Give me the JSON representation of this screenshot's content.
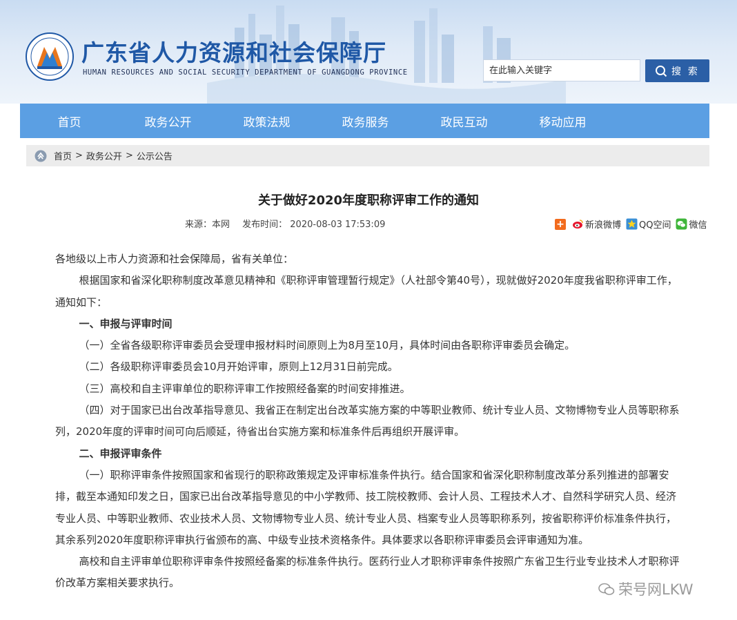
{
  "header": {
    "title": "广东省人力资源和社会保障厅",
    "subtitle": "HUMAN RESOURCES AND SOCIAL SECURITY DEPARTMENT OF GUANGDONG PROVINCE",
    "search_placeholder": "在此输入关键字",
    "search_button": "搜 索"
  },
  "nav": {
    "items": [
      "首页",
      "政务公开",
      "政策法规",
      "政务服务",
      "政民互动",
      "移动应用"
    ]
  },
  "breadcrumb": {
    "items": [
      "首页",
      "政务公开",
      "公示公告"
    ],
    "separator": ">"
  },
  "article": {
    "title": "关于做好2020年度职称评审工作的通知",
    "source": "来源：本网",
    "published": "发布时间： 2020-08-03 17:53:09",
    "paragraphs": [
      "各地级以上市人力资源和社会保障局，省有关单位：",
      "根据国家和省深化职称制度改革意见精神和《职称评审管理暂行规定》（人社部令第40号），现就做好2020年度我省职称评审工作，通知如下：",
      "一、申报与评审时间",
      "（一）全省各级职称评审委员会受理申报材料时间原则上为8月至10月，具体时间由各职称评审委员会确定。",
      "（二）各级职称评审委员会10月开始评审，原则上12月31日前完成。",
      "（三）高校和自主评审单位的职称评审工作按照经备案的时间安排推进。",
      "（四）对于国家已出台改革指导意见、我省正在制定出台改革实施方案的中等职业教师、统计专业人员、文物博物专业人员等职称系列，2020年度的评审时间可向后顺延，待省出台实施方案和标准条件后再组织开展评审。",
      "二、申报评审条件",
      "（一）职称评审条件按照国家和省现行的职称政策规定及评审标准条件执行。结合国家和省深化职称制度改革分系列推进的部署安排，截至本通知印发之日，国家已出台改革指导意见的中小学教师、技工院校教师、会计人员、工程技术人才、自然科学研究人员、经济专业人员、中等职业教师、农业技术人员、文物博物专业人员、统计专业人员、档案专业人员等职称系列，按省职称评价标准条件执行，其余系列2020年度职称评审执行省颁布的高、中级专业技术资格条件。具体要求以各职称评审委员会评审通知为准。",
      "高校和自主评审单位职称评审条件按照经备案的标准条件执行。医药行业人才职称评审条件按照广东省卫生行业专业技术人才职称评价改革方案相关要求执行。"
    ]
  },
  "share": {
    "weibo": "新浪微博",
    "qzone": "QQ空间",
    "wechat": "微信"
  },
  "watermark": "荣号网LKW",
  "colors": {
    "nav_bg": "#5b9fe3",
    "title_blue": "#1f58a6",
    "search_button_bg": "#2b5fa6",
    "breadcrumb_bg": "#ececec"
  }
}
